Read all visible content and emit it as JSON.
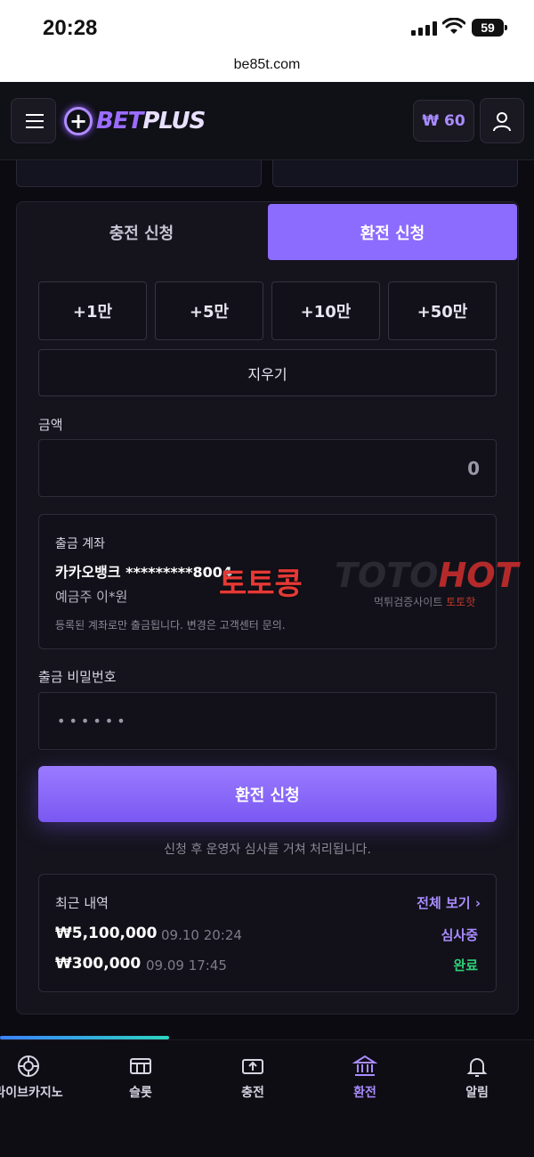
{
  "status_bar": {
    "time": "20:28",
    "battery": "59"
  },
  "browser": {
    "url": "be85t.com"
  },
  "header": {
    "logo_text_a": "BET",
    "logo_text_b": "PLUS",
    "balance": "₩ 60"
  },
  "tabs": {
    "deposit": "충전 신청",
    "withdraw": "환전 신청"
  },
  "amount_buttons": [
    "+1만",
    "+5만",
    "+10만",
    "+50만"
  ],
  "clear_label": "지우기",
  "amount": {
    "label": "금액",
    "value": "0"
  },
  "account": {
    "title": "출금 계좌",
    "bank": "카카오뱅크 *********8004",
    "holder": "예금주 이*원",
    "note": "등록된 계좌로만 출금됩니다. 변경은 고객센터 문의."
  },
  "password": {
    "label": "출금 비밀번호",
    "value": "••••••"
  },
  "submit": {
    "label": "환전 신청",
    "note": "신청 후 운영자 심사를 거쳐 처리됩니다."
  },
  "history": {
    "title": "최근 내역",
    "view_all": "전체 보기 ›",
    "rows": [
      {
        "amount": "₩5,100,000",
        "date": "09.10 20:24",
        "status": "심사중",
        "status_color": "#a98cff"
      },
      {
        "amount": "₩300,000",
        "date": "09.09 17:45",
        "status": "완료",
        "status_color": "#2fd07a"
      }
    ]
  },
  "watermark": {
    "korean": "토토콩",
    "en_a": "TOTO",
    "en_b": "HOT",
    "sub_a": "먹튀검증사이트",
    "sub_b": "토토핫"
  },
  "bottom_nav": [
    {
      "label": "라이브카지노",
      "icon": "chip-icon"
    },
    {
      "label": "슬롯",
      "icon": "slot-icon"
    },
    {
      "label": "충전",
      "icon": "deposit-icon"
    },
    {
      "label": "환전",
      "icon": "bank-icon",
      "active": true
    },
    {
      "label": "알림",
      "icon": "bell-icon"
    }
  ],
  "colors": {
    "accent": "#8c6bff",
    "background": "#0c0b12",
    "card": "#15141d"
  }
}
